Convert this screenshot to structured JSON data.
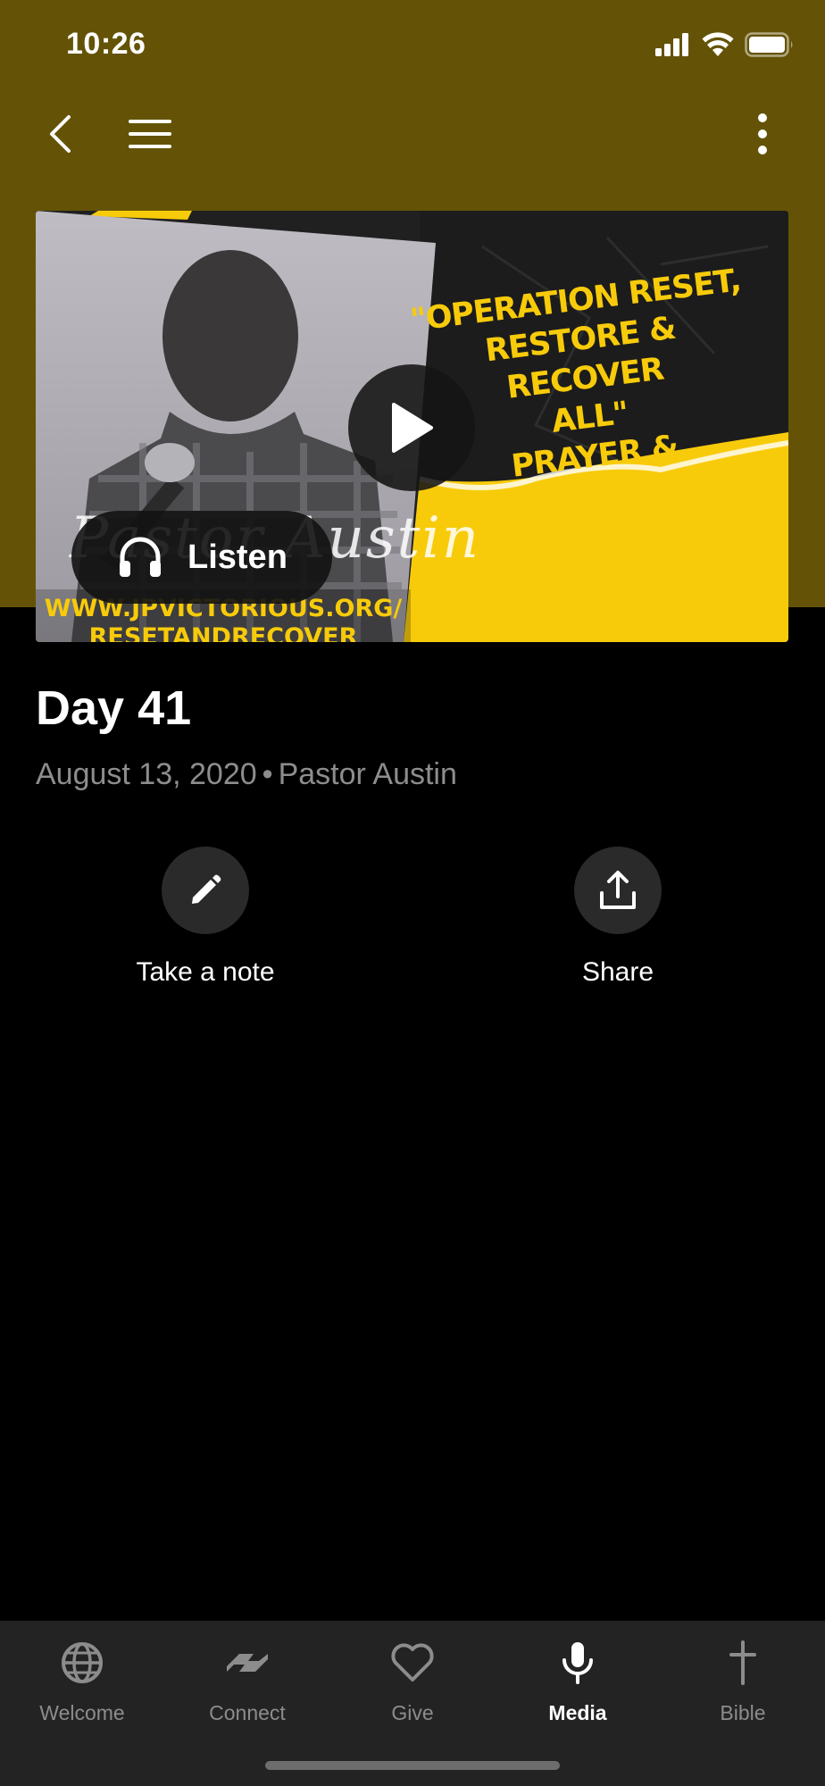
{
  "status_bar": {
    "time": "10:26"
  },
  "colors": {
    "header_bg": "#645306",
    "accent_yellow": "#f8cb0a",
    "tab_bar_bg": "#232323"
  },
  "hero": {
    "title_lines": [
      "\"OPERATION RESET,",
      "RESTORE & RECOVER",
      "ALL\"",
      "PRAYER & COMMUNION"
    ],
    "url_lines": [
      "WWW.JPVICTORIOUS.ORG/",
      "RESETANDRECOVER"
    ],
    "script_text": "Pastor Austin",
    "listen_label": "Listen"
  },
  "sermon": {
    "title": "Day 41",
    "date": "August 13, 2020",
    "separator": "•",
    "speaker": "Pastor Austin"
  },
  "actions": [
    {
      "label": "Take a note",
      "icon": "pencil-icon"
    },
    {
      "label": "Share",
      "icon": "share-icon"
    }
  ],
  "tabs": [
    {
      "label": "Welcome",
      "icon": "globe-icon",
      "active": false
    },
    {
      "label": "Connect",
      "icon": "handshake-icon",
      "active": false
    },
    {
      "label": "Give",
      "icon": "heart-icon",
      "active": false
    },
    {
      "label": "Media",
      "icon": "microphone-icon",
      "active": true
    },
    {
      "label": "Bible",
      "icon": "cross-icon",
      "active": false
    }
  ]
}
